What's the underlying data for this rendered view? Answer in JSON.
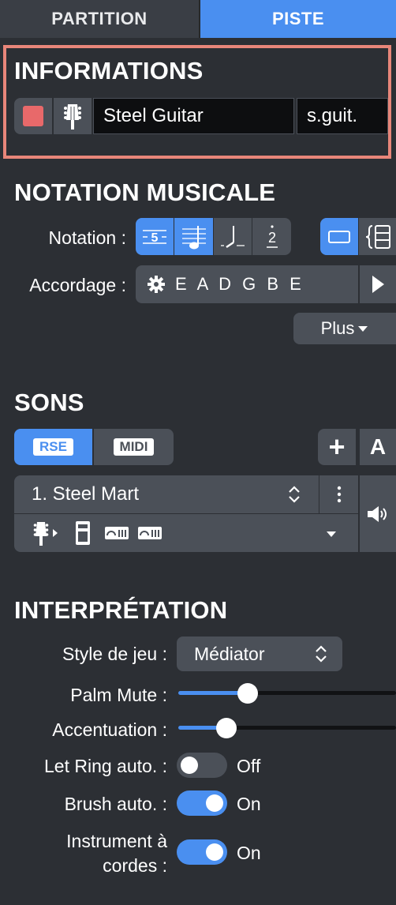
{
  "tabs": {
    "partition": "PARTITION",
    "piste": "PISTE"
  },
  "informations": {
    "title": "INFORMATIONS",
    "track_color": "#e8696a",
    "instrument_icon": "guitar-headstock-icon",
    "track_name": "Steel Guitar",
    "short_name": "s.guit."
  },
  "notation": {
    "title": "NOTATION MUSICALE",
    "notation_label": "Notation :",
    "tab_digit": "5",
    "numbered_digit": "2",
    "tuning_label": "Accordage :",
    "tuning_value": "E A D G B E",
    "more_button": "Plus"
  },
  "sounds": {
    "title": "SONS",
    "rse_label": "RSE",
    "midi_label": "MIDI",
    "add_label": "+",
    "auto_label": "A",
    "preset": "1. Steel Mart"
  },
  "interpretation": {
    "title": "INTERPRÉTATION",
    "style_label": "Style de jeu :",
    "style_value": "Médiator",
    "palm_mute_label": "Palm Mute :",
    "palm_mute_level": 0.32,
    "accent_label": "Accentuation :",
    "accent_level": 0.22,
    "let_ring_label": "Let Ring auto. :",
    "let_ring_state": "Off",
    "brush_label": "Brush auto. :",
    "brush_state": "On",
    "string_label_line1": "Instrument à",
    "string_label_line2": "cordes :",
    "string_state": "On"
  },
  "colors": {
    "accent": "#4a8ff0",
    "background": "#2c2f34",
    "highlight_frame": "#e8867a"
  }
}
